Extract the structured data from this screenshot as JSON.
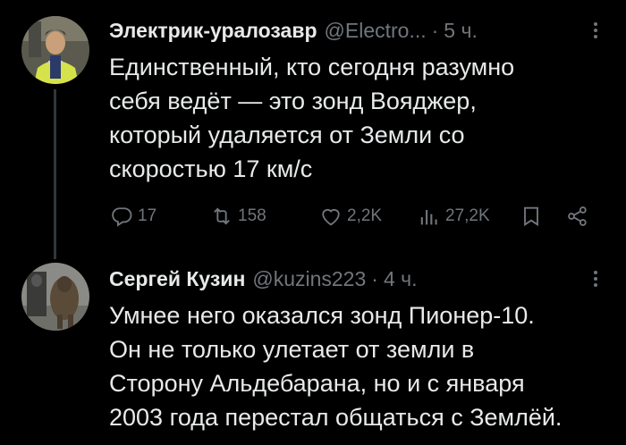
{
  "tweets": [
    {
      "author": "Электрик-уралозавр",
      "handle": "@Electro...",
      "separator": "·",
      "time": "5 ч.",
      "text": "Единственный, кто сегодня разумно\nсебя ведёт — это зонд Вояджер,\nкоторый удаляется от Земли со\nскоростью 17 км/с",
      "stats": {
        "replies": "17",
        "retweets": "158",
        "likes": "2,2K",
        "views": "27,2K"
      }
    },
    {
      "author": "Сергей Кузин",
      "handle": "@kuzins223",
      "separator": "·",
      "time": "4 ч.",
      "text": "Умнее него оказался зонд Пионер-10.\nОн не только улетает от земли в\nСторону Альдебарана,  но и с января\n2003 года перестал общаться с Землёй."
    }
  ],
  "icons": {
    "reply": "reply-icon",
    "retweet": "retweet-icon",
    "like": "heart-icon",
    "views": "views-icon",
    "bookmark": "bookmark-icon",
    "share": "share-icon",
    "more": "more-vertical-icon"
  },
  "colors": {
    "background": "#000000",
    "text": "#e7e9ea",
    "muted": "#71767b"
  }
}
